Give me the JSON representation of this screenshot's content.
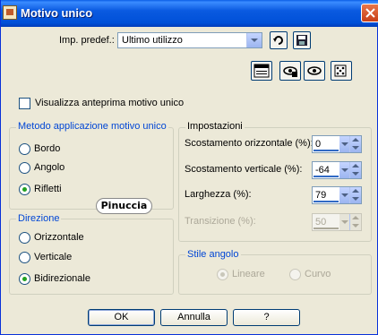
{
  "window": {
    "title": "Motivo unico"
  },
  "preset": {
    "label": "Imp. predef.:",
    "value": "Ultimo utilizzo"
  },
  "preview_checkbox": {
    "label": "Visualizza anteprima motivo unico",
    "checked": false
  },
  "method_group": {
    "title": "Metodo applicazione motivo unico",
    "options": [
      {
        "label": "Bordo",
        "selected": false
      },
      {
        "label": "Angolo",
        "selected": false
      },
      {
        "label": "Rifletti",
        "selected": true
      }
    ]
  },
  "direction_group": {
    "title": "Direzione",
    "options": [
      {
        "label": "Orizzontale",
        "selected": false
      },
      {
        "label": "Verticale",
        "selected": false
      },
      {
        "label": "Bidirezionale",
        "selected": true
      }
    ]
  },
  "settings_group": {
    "title": "Impostazioni",
    "fields": [
      {
        "label": "Scostamento orizzontale (%):",
        "value": "0",
        "enabled": true
      },
      {
        "label": "Scostamento verticale (%):",
        "value": "-64",
        "enabled": true
      },
      {
        "label": "Larghezza (%):",
        "value": "79",
        "enabled": true
      },
      {
        "label": "Transizione (%):",
        "value": "50",
        "enabled": false
      }
    ]
  },
  "corner_group": {
    "title": "Stile angolo",
    "options": [
      {
        "label": "Lineare",
        "selected": true,
        "enabled": false
      },
      {
        "label": "Curvo",
        "selected": false,
        "enabled": false
      }
    ]
  },
  "watermark": "Pinuccia",
  "buttons": {
    "ok": "OK",
    "cancel": "Annulla",
    "help": "?"
  },
  "colors": {
    "titlebar": "#0a5ae0",
    "dialog_bg": "#ece9d8",
    "group_title": "#0046d5",
    "radio_dot": "#21a121"
  }
}
